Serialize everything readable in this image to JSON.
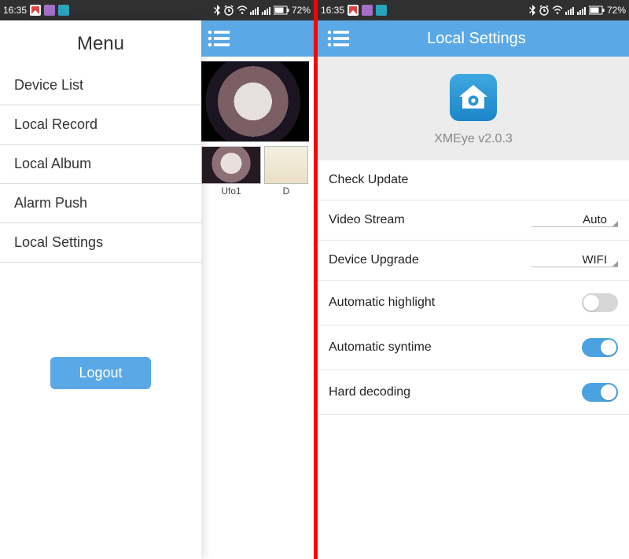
{
  "status": {
    "time": "16:35",
    "battery": "72%"
  },
  "phoneA": {
    "drawer": {
      "title": "Menu",
      "items": [
        "Device List",
        "Local Record",
        "Local Album",
        "Alarm Push",
        "Local Settings"
      ],
      "logout": "Logout"
    },
    "viewer": {
      "thumb1_label": "Ufo1",
      "thumb2_label": "D"
    }
  },
  "phoneB": {
    "title": "Local Settings",
    "brand": {
      "name": "XMEye v2.0.3"
    },
    "rows": {
      "check_update": "Check Update",
      "video_stream": {
        "label": "Video Stream",
        "value": "Auto"
      },
      "device_upgrade": {
        "label": "Device Upgrade",
        "value": "WIFI"
      },
      "auto_highlight": {
        "label": "Automatic highlight",
        "on": false
      },
      "auto_syntime": {
        "label": "Automatic syntime",
        "on": true
      },
      "hard_decoding": {
        "label": "Hard decoding",
        "on": true
      }
    }
  }
}
